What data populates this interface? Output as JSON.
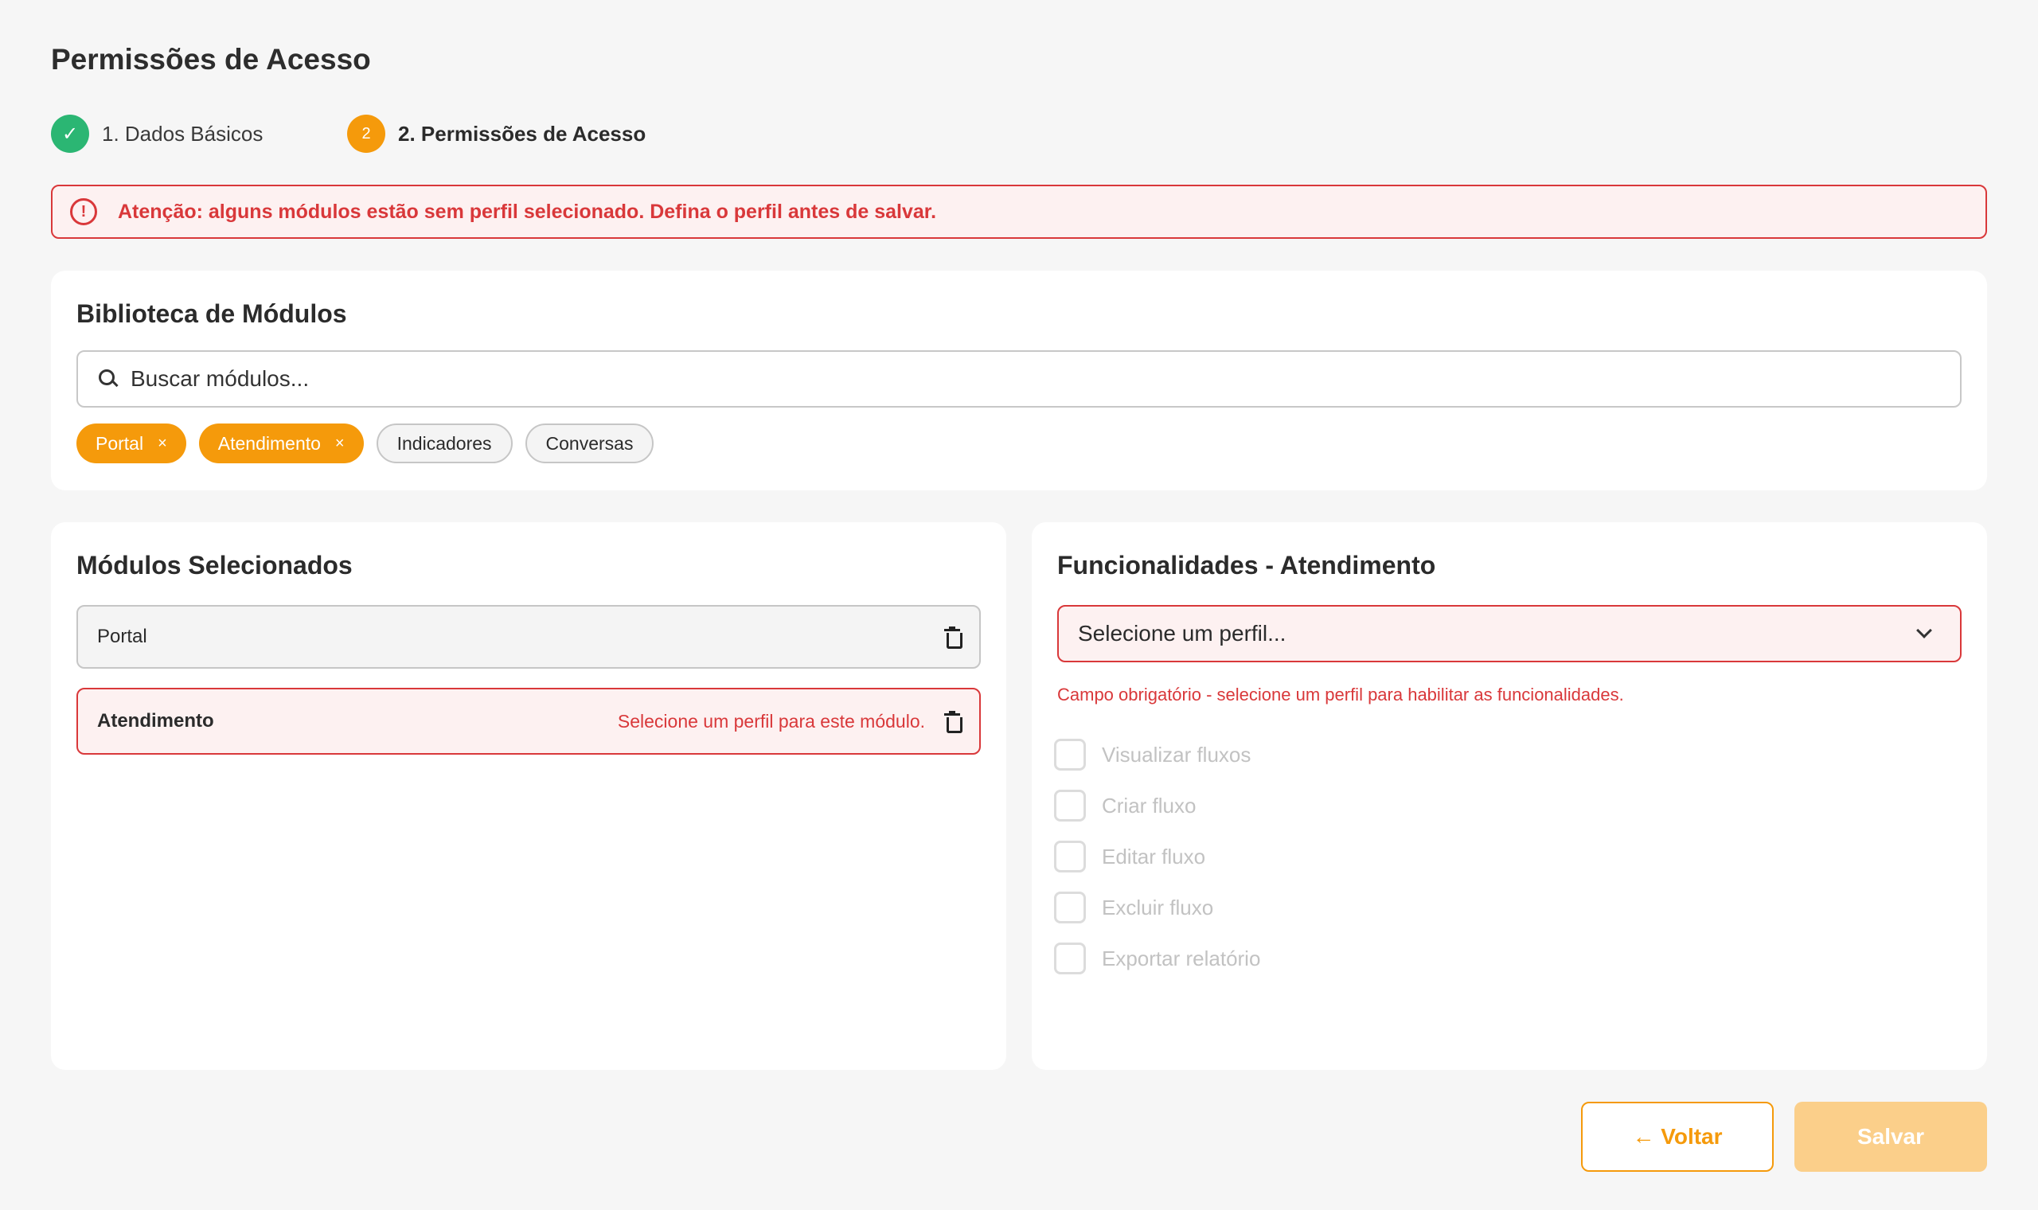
{
  "page": {
    "title": "Permissões de Acesso"
  },
  "stepper": {
    "steps": [
      {
        "label": "1. Dados Básicos",
        "state": "done",
        "icon": "check-icon",
        "marker": "✓"
      },
      {
        "label": "2. Permissões de Acesso",
        "state": "active",
        "marker": "2"
      }
    ]
  },
  "alert": {
    "icon": "alert-circle-icon",
    "icon_glyph": "!",
    "text": "Atenção: alguns módulos estão sem perfil selecionado. Defina o perfil antes de salvar."
  },
  "library": {
    "title": "Biblioteca de Módulos",
    "search": {
      "placeholder": "Buscar módulos...",
      "value": ""
    },
    "chips": [
      {
        "label": "Portal",
        "selected": true,
        "remove": "×"
      },
      {
        "label": "Atendimento",
        "selected": true,
        "remove": "×"
      },
      {
        "label": "Indicadores",
        "selected": false
      },
      {
        "label": "Conversas",
        "selected": false
      }
    ]
  },
  "selected_modules": {
    "title": "Módulos Selecionados",
    "items": [
      {
        "name": "Portal",
        "error": ""
      },
      {
        "name": "Atendimento",
        "error": "Selecione um perfil para este módulo."
      }
    ]
  },
  "functionalities": {
    "title": "Funcionalidades - Atendimento",
    "profile_select": {
      "value": "Selecione um perfil..."
    },
    "error": "Campo obrigatório - selecione um perfil para habilitar as funcionalidades.",
    "items": [
      {
        "label": "Visualizar fluxos",
        "checked": false,
        "disabled": true
      },
      {
        "label": "Criar fluxo",
        "checked": false,
        "disabled": true
      },
      {
        "label": "Editar fluxo",
        "checked": false,
        "disabled": true
      },
      {
        "label": "Excluir fluxo",
        "checked": false,
        "disabled": true
      },
      {
        "label": "Exportar relatório",
        "checked": false,
        "disabled": true
      }
    ]
  },
  "footer": {
    "back_label": "← Voltar",
    "save_label": "Salvar"
  },
  "colors": {
    "accent": "#f59a0b",
    "success": "#2bb673",
    "error": "#d9383a",
    "save_disabled": "#fbcf8a"
  }
}
